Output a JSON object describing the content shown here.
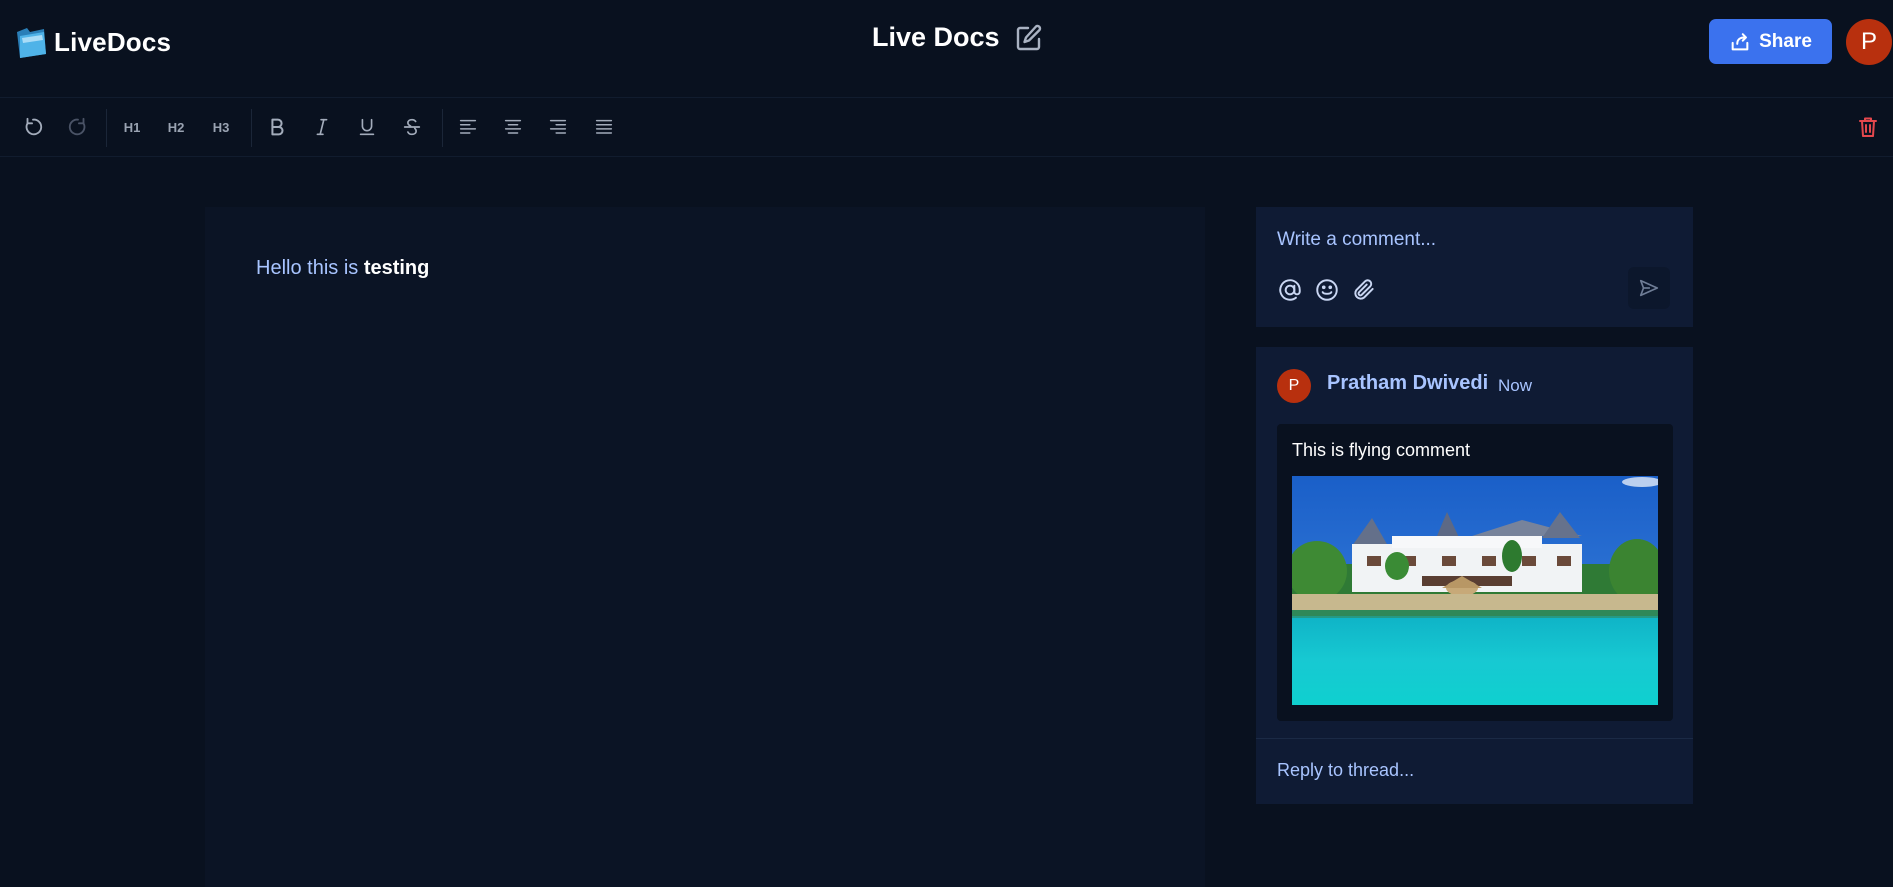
{
  "app": {
    "name": "LiveDocs"
  },
  "header": {
    "document_title": "Live Docs",
    "share_label": "Share",
    "user_initial": "P"
  },
  "toolbar": {
    "buttons": [
      "undo-icon",
      "redo-icon",
      "H1",
      "H2",
      "H3",
      "bold-icon",
      "italic-icon",
      "underline-icon",
      "strikethrough-icon",
      "align-left-icon",
      "align-center-icon",
      "align-right-icon",
      "align-justify-icon"
    ],
    "h1": "H1",
    "h2": "H2",
    "h3": "H3",
    "delete_icon": "trash-icon"
  },
  "editor": {
    "text_light": "Hello this is ",
    "text_bold": "testing"
  },
  "composer": {
    "placeholder": "Write a comment...",
    "icons": [
      "mention-icon",
      "emoji-icon",
      "attachment-icon",
      "send-icon"
    ]
  },
  "thread": {
    "author_initial": "P",
    "author": "Pratham Dwivedi",
    "time": "Now",
    "comment": "This is flying comment",
    "reply_placeholder": "Reply to thread..."
  },
  "colors": {
    "background": "#09111f",
    "panel": "#0f1b34",
    "editor": "#0b1425",
    "accent": "#3b72ee",
    "avatar": "#b8300e",
    "link_text": "#a8c4ff",
    "danger": "#e5484d"
  }
}
